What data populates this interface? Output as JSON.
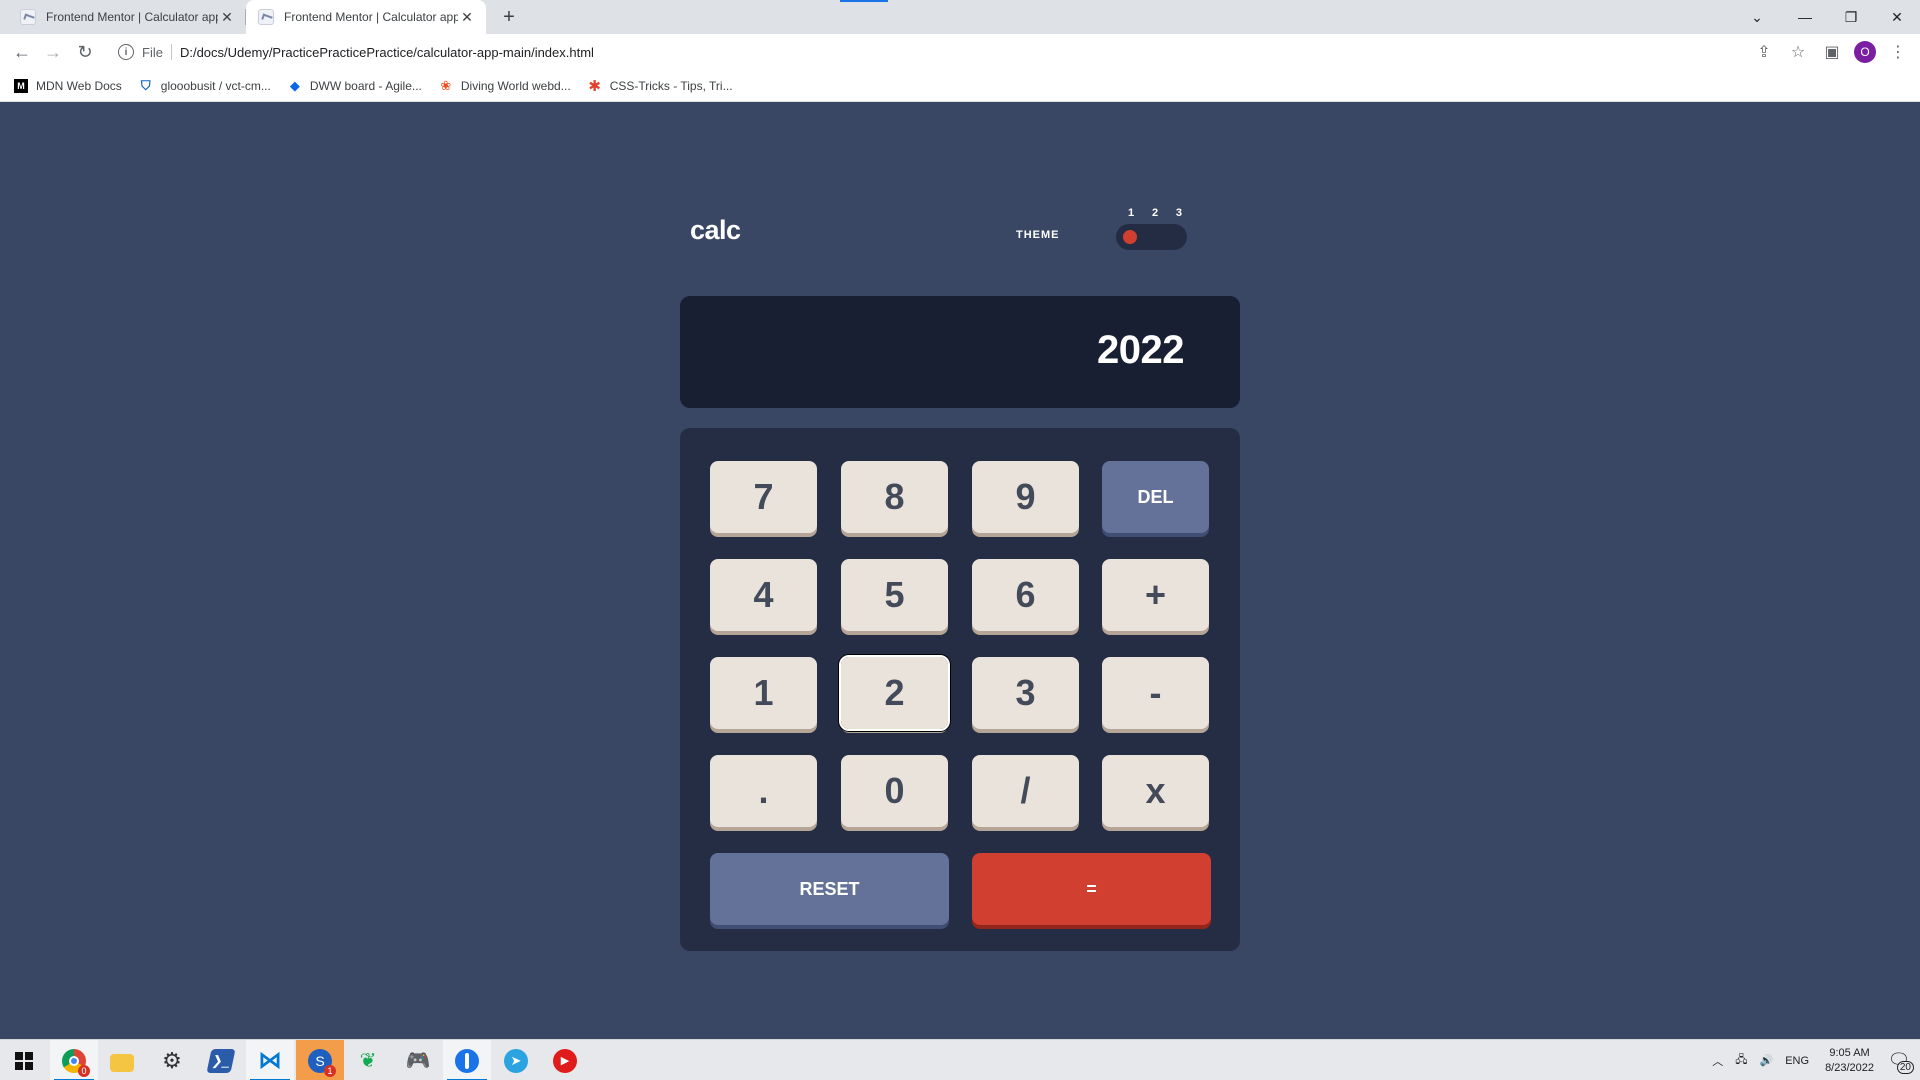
{
  "browser": {
    "tabs": [
      {
        "title": "Frontend Mentor | Calculator app",
        "active": false
      },
      {
        "title": "Frontend Mentor | Calculator app",
        "active": true
      }
    ],
    "scheme": "File",
    "url": "D:/docs/Udemy/PracticePracticePractice/calculator-app-main/index.html",
    "bookmarks": [
      {
        "label": "MDN Web Docs",
        "icon": "mdn-icon"
      },
      {
        "label": "glooobusit / vct-cm...",
        "icon": "bitbucket-icon"
      },
      {
        "label": "DWW board - Agile...",
        "icon": "jira-icon"
      },
      {
        "label": "Diving World webd...",
        "icon": "figma-icon"
      },
      {
        "label": "CSS-Tricks - Tips, Tri...",
        "icon": "css-tricks-icon"
      }
    ],
    "profile_initial": "O"
  },
  "calculator": {
    "logo": "calc",
    "theme_label": "THEME",
    "theme_options": [
      "1",
      "2",
      "3"
    ],
    "active_theme": 1,
    "display_value": "2022",
    "keys": {
      "k7": "7",
      "k8": "8",
      "k9": "9",
      "del": "DEL",
      "k4": "4",
      "k5": "5",
      "k6": "6",
      "plus": "+",
      "k1": "1",
      "k2": "2",
      "k3": "3",
      "minus": "-",
      "dot": ".",
      "k0": "0",
      "divide": "/",
      "times": "x",
      "reset": "RESET",
      "equals": "="
    },
    "focused_key": "2",
    "colors": {
      "page_bg": "#3a4764",
      "screen_bg": "#181f32",
      "keypad_bg": "#242d44",
      "key_bg": "#eae3db",
      "key_text": "#434a59",
      "accent_blue": "#647198",
      "accent_red": "#d03f2f"
    }
  },
  "taskbar": {
    "apps": [
      "start-icon",
      "chrome-icon",
      "file-explorer-icon",
      "settings-icon",
      "powershell-icon",
      "vscode-icon",
      "sourcetree-icon",
      "mongodb-icon",
      "gaming-icon",
      "vpn-icon",
      "telegram-icon",
      "youtube-music-icon"
    ],
    "chrome_badge": "0",
    "sourcetree_badge": "1",
    "language": "ENG",
    "time": "9:05 AM",
    "date": "8/23/2022",
    "notification_count": "20"
  }
}
